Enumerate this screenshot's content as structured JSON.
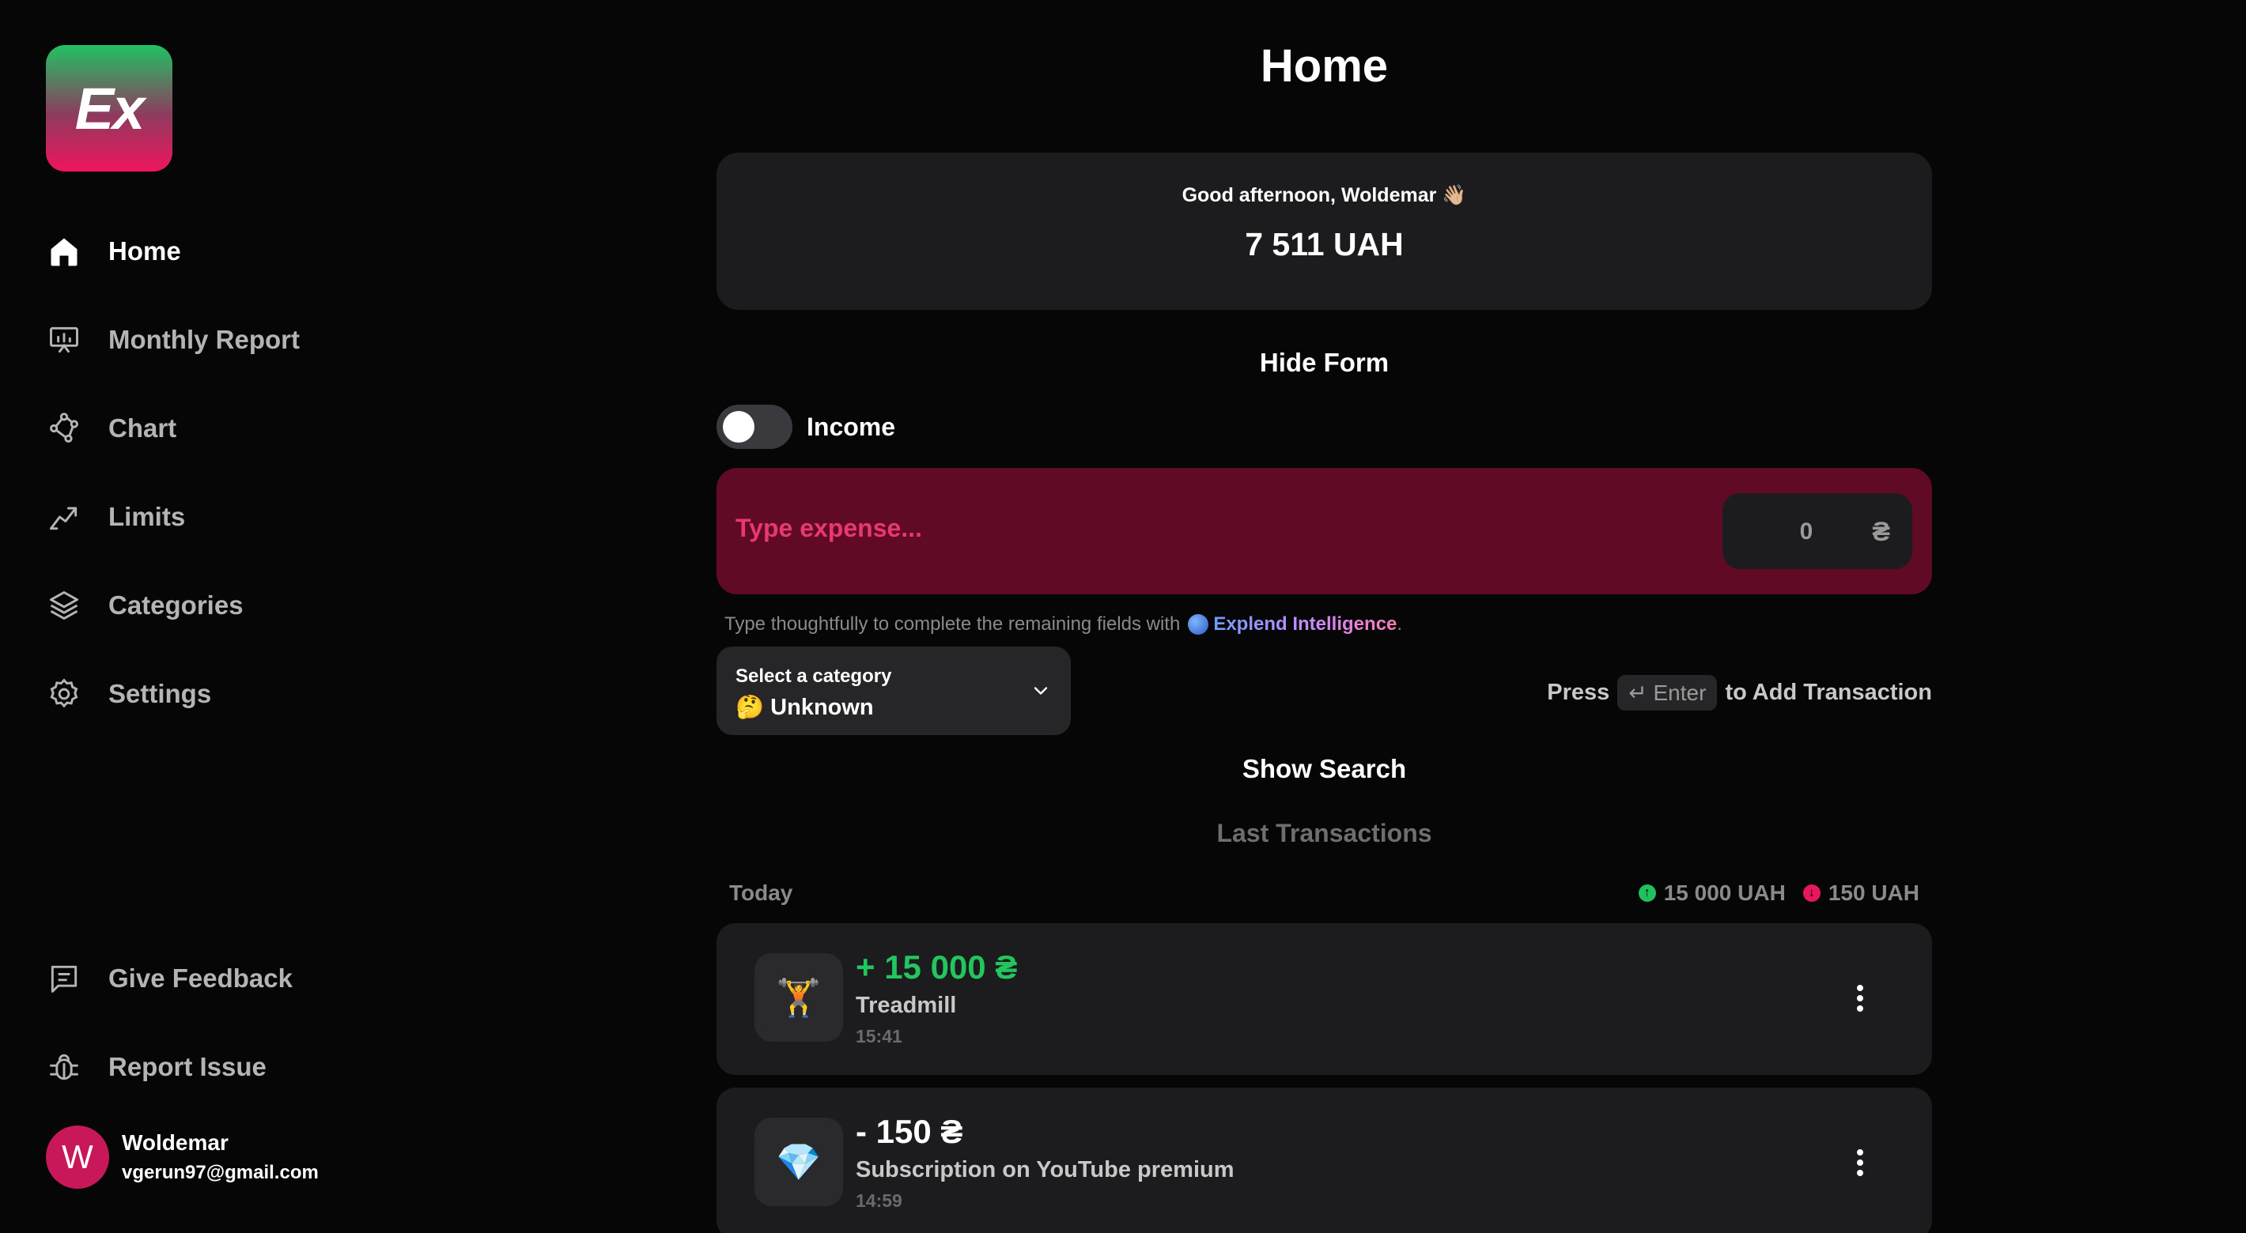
{
  "app": {
    "logo_text": "Ex",
    "brand_colors": {
      "logo_top": "#21c163",
      "logo_bottom": "#f0145e",
      "income": "#22c55e",
      "expense": "#e8175d"
    }
  },
  "sidebar": {
    "items": [
      {
        "label": "Home",
        "icon": "home-icon",
        "active": true
      },
      {
        "label": "Monthly Report",
        "icon": "presentation-chart-icon"
      },
      {
        "label": "Chart",
        "icon": "graph-nodes-icon"
      },
      {
        "label": "Limits",
        "icon": "trend-up-icon"
      },
      {
        "label": "Categories",
        "icon": "layers-icon"
      },
      {
        "label": "Settings",
        "icon": "gear-icon"
      }
    ],
    "bottom_items": [
      {
        "label": "Give Feedback",
        "icon": "message-icon"
      },
      {
        "label": "Report Issue",
        "icon": "bug-icon"
      }
    ],
    "user": {
      "initial": "W",
      "name": "Woldemar",
      "email": "vgerun97@gmail.com"
    }
  },
  "main": {
    "title": "Home",
    "greeting": "Good afternoon, Woldemar 👋🏼",
    "balance": "7 511 UAH",
    "hide_form": "Hide Form",
    "toggle_label": "Income",
    "expense_placeholder": "Type expense...",
    "amount_value": "0",
    "currency_symbol": "₴",
    "hint_prefix": "Type thoughtfully to complete the remaining fields with",
    "hint_brand": "Explend Intelligence",
    "hint_suffix": ".",
    "category_label": "Select a category",
    "category_value": "🤔 Unknown",
    "press_prefix": "Press",
    "press_key": "↵ Enter",
    "press_suffix": "to Add Transaction",
    "show_search": "Show Search",
    "last_transactions": "Last Transactions",
    "day": "Today",
    "total_income": "15 000 UAH",
    "total_expense": "150 UAH",
    "transactions": [
      {
        "emoji": "🏋️",
        "amount": "+ 15 000 ₴",
        "name": "Treadmill",
        "time": "15:41",
        "type": "income"
      },
      {
        "emoji": "💎",
        "amount": "- 150 ₴",
        "name": "Subscription on YouTube premium",
        "time": "14:59",
        "type": "expense"
      }
    ]
  }
}
